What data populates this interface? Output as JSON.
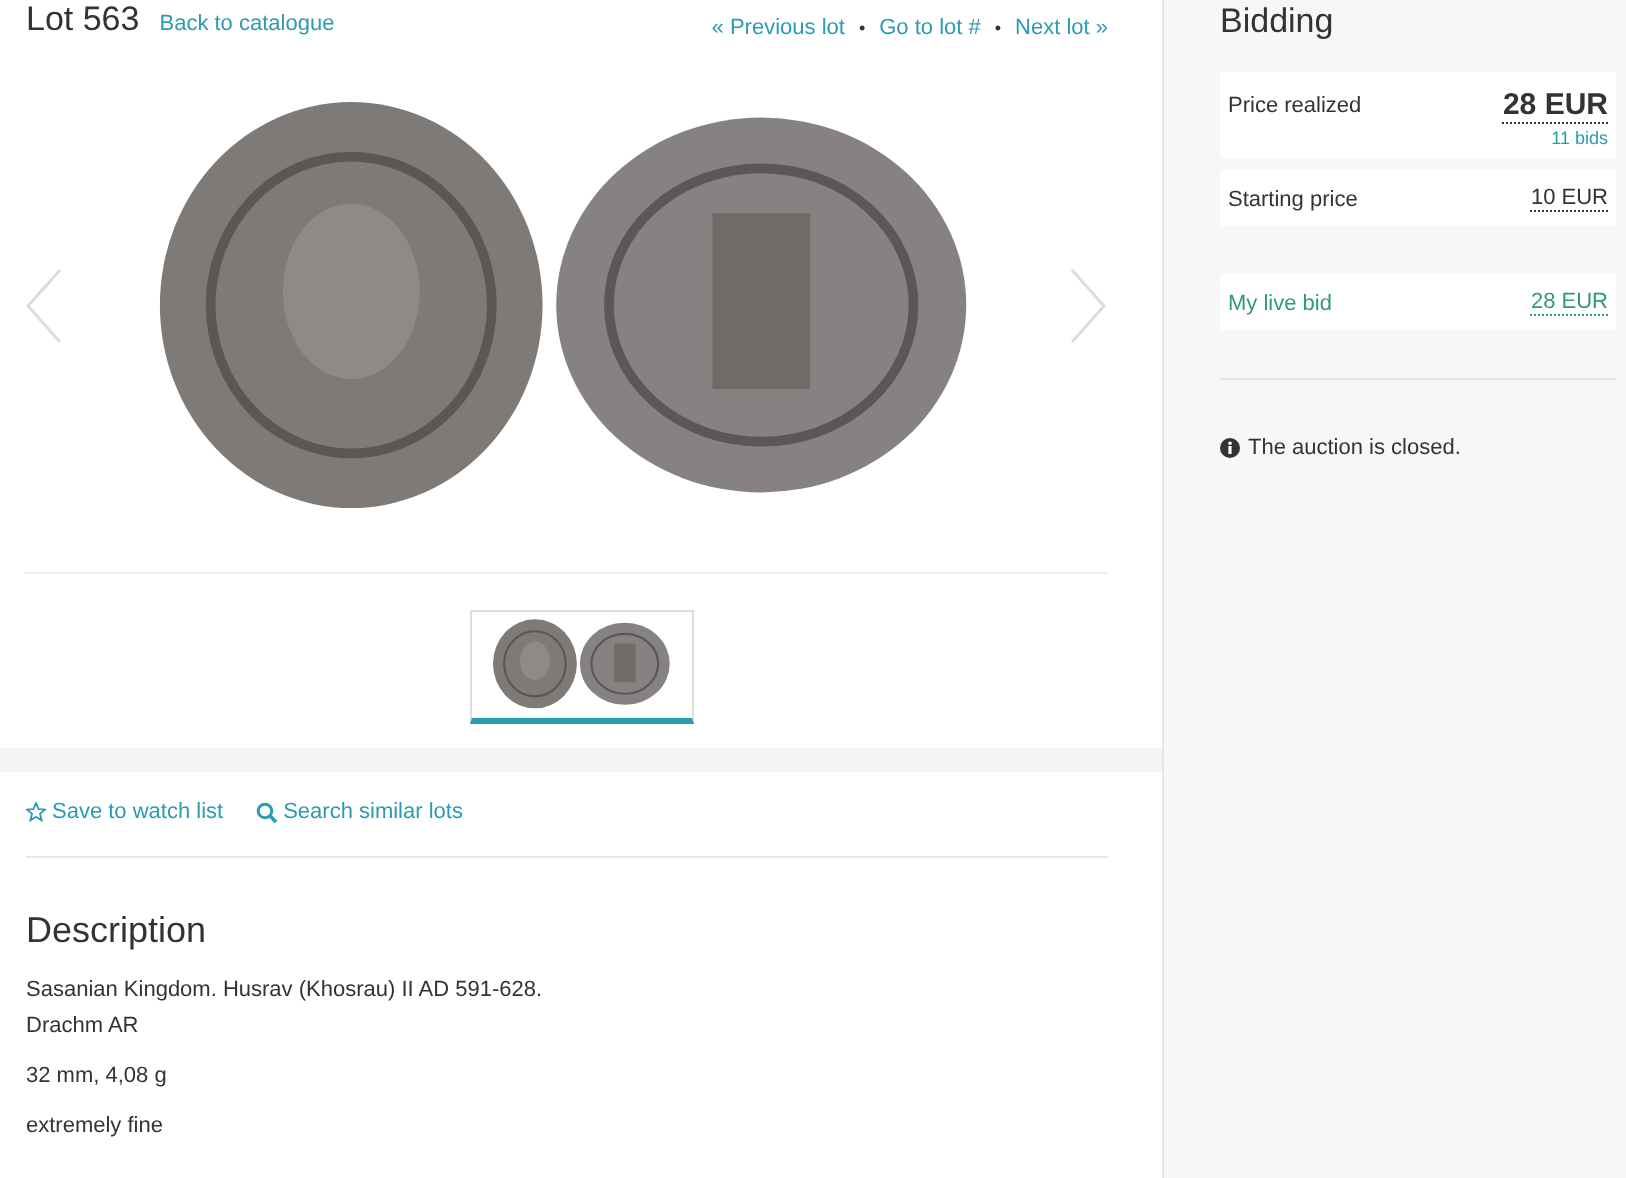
{
  "lot": {
    "title": "Lot 563",
    "back_link": "Back to catalogue",
    "nav": [
      {
        "kind": "link",
        "label": "« Previous lot"
      },
      {
        "kind": "separator",
        "label": "•"
      },
      {
        "kind": "link",
        "label": "Go to lot #"
      },
      {
        "kind": "separator",
        "label": "•"
      },
      {
        "kind": "link",
        "label": "Next lot »"
      }
    ]
  },
  "gallery": {
    "thumbnails": [
      {
        "selected": true
      }
    ]
  },
  "actions": [
    {
      "kind": "star",
      "label": "Save to watch list"
    },
    {
      "kind": "search",
      "label": "Search similar lots"
    }
  ],
  "description": {
    "heading": "Description",
    "lines": [
      "Sasanian Kingdom. Husrav (Khosrau) II AD 591-628.",
      "Drachm AR"
    ],
    "paragraphs": [
      "32 mm, 4,08 g",
      "extremely fine"
    ]
  },
  "bidding": {
    "heading": "Bidding",
    "rows": [
      {
        "kind": "main",
        "label": "Price realized",
        "value": "28 EUR",
        "note": "11 bids"
      },
      {
        "kind": "plain",
        "label": "Starting price",
        "value": "10 EUR"
      },
      {
        "kind": "mine",
        "label": "My live bid",
        "value": "28 EUR"
      }
    ],
    "status": "The auction is closed."
  }
}
